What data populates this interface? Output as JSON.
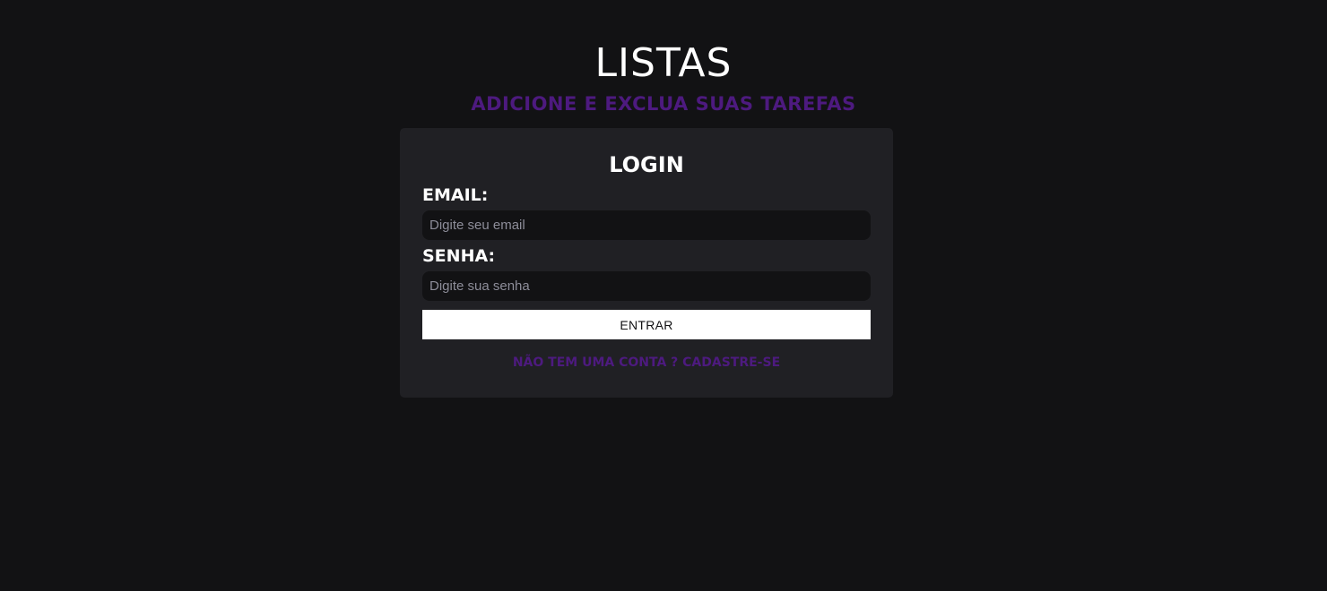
{
  "header": {
    "title": "LISTAS",
    "subtitle": "ADICIONE E EXCLUA SUAS TAREFAS"
  },
  "login": {
    "title": "LOGIN",
    "email_label": "EMAIL:",
    "email_placeholder": "Digite seu email",
    "email_value": "",
    "password_label": "SENHA:",
    "password_placeholder": "Digite sua senha",
    "password_value": "",
    "submit_label": "ENTRAR",
    "signup_link": "NÃO TEM UMA CONTA ? CADASTRE-SE"
  },
  "colors": {
    "background": "#121214",
    "card": "#202024",
    "accent": "#4d1a7f",
    "text": "#ffffff"
  }
}
